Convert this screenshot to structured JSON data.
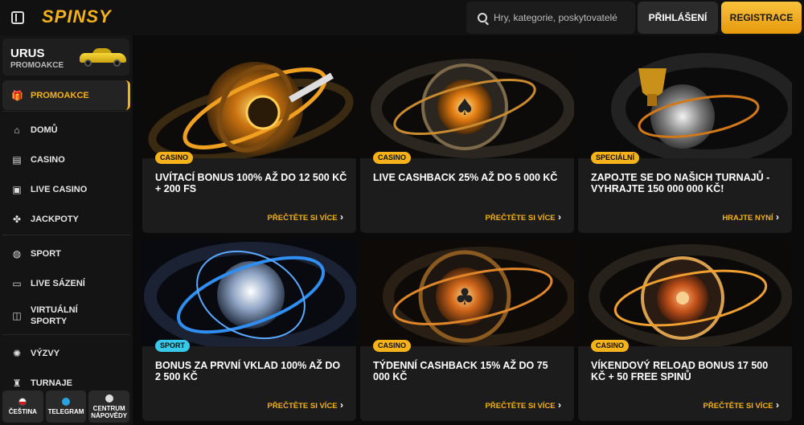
{
  "header": {
    "logo": "SPINSY",
    "search_placeholder": "Hry, kategorie, poskytovatelé",
    "login_label": "PŘIHLÁŠENÍ",
    "register_label": "REGISTRACE"
  },
  "sidebar": {
    "promo_title": "URUS",
    "promo_subtitle": "PROMOAKCE",
    "items": [
      {
        "label": "PROMOAKCE",
        "icon": "gift-icon",
        "glyph": "🎁"
      },
      {
        "label": "DOMŮ",
        "icon": "home-icon",
        "glyph": "⌂"
      },
      {
        "label": "CASINO",
        "icon": "slot-machine-icon",
        "glyph": "▤"
      },
      {
        "label": "LIVE CASINO",
        "icon": "live-casino-icon",
        "glyph": "▣"
      },
      {
        "label": "JACKPOTY",
        "icon": "clover-icon",
        "glyph": "✤"
      },
      {
        "label": "SPORT",
        "icon": "ball-icon",
        "glyph": "◍"
      },
      {
        "label": "LIVE SÁZENÍ",
        "icon": "live-betting-icon",
        "glyph": "▭"
      },
      {
        "label": "VIRTUÁLNÍ SPORTY",
        "icon": "gamepad-icon",
        "glyph": "◫"
      },
      {
        "label": "VÝZVY",
        "icon": "challenge-icon",
        "glyph": "✺"
      },
      {
        "label": "TURNAJE",
        "icon": "trophy-icon",
        "glyph": "♜"
      }
    ],
    "bottom": [
      {
        "label": "ČEŠTINA",
        "icon": "flag-cz-icon",
        "color": "#d7141a"
      },
      {
        "label": "TELEGRAM",
        "icon": "telegram-icon",
        "color": "#2aa3de"
      },
      {
        "label": "CENTRUM NÁPOVĚDY",
        "icon": "help-icon",
        "color": "#dddddd"
      }
    ]
  },
  "cards": [
    {
      "badge": "CASINO",
      "title": "UVÍTACÍ BONUS 100% AŽ DO 12 500 KČ + 200 FS",
      "link": "PŘEČTĚTE SI VÍCE"
    },
    {
      "badge": "CASINO",
      "title": "LIVE CASHBACK 25% AŽ DO 5 000 KČ",
      "link": "PŘEČTĚTE SI VÍCE"
    },
    {
      "badge": "SPECIÁLNÍ",
      "title": "ZAPOJTE SE DO NAŠICH TURNAJŮ - VYHRAJTE 150 000 000 KČ!",
      "link": "HRAJTE NYNÍ"
    },
    {
      "badge": "SPORT",
      "title": "BONUS ZA PRVNÍ VKLAD 100% AŽ DO 2 500 KČ",
      "link": "PŘEČTĚTE SI VÍCE"
    },
    {
      "badge": "CASINO",
      "title": "TÝDENNÍ CASHBACK 15% AŽ DO 75 000 KČ",
      "link": "PŘEČTĚTE SI VÍCE"
    },
    {
      "badge": "CASINO",
      "title": "VÍKENDOVÝ RELOAD BONUS 17 500 KČ + 50 FREE SPINŮ",
      "link": "PŘEČTĚTE SI VÍCE"
    }
  ],
  "colors": {
    "accent": "#f5b21a",
    "sport_badge": "#38c8e8",
    "background": "#0e0e0e",
    "card": "#1c1c1c"
  }
}
